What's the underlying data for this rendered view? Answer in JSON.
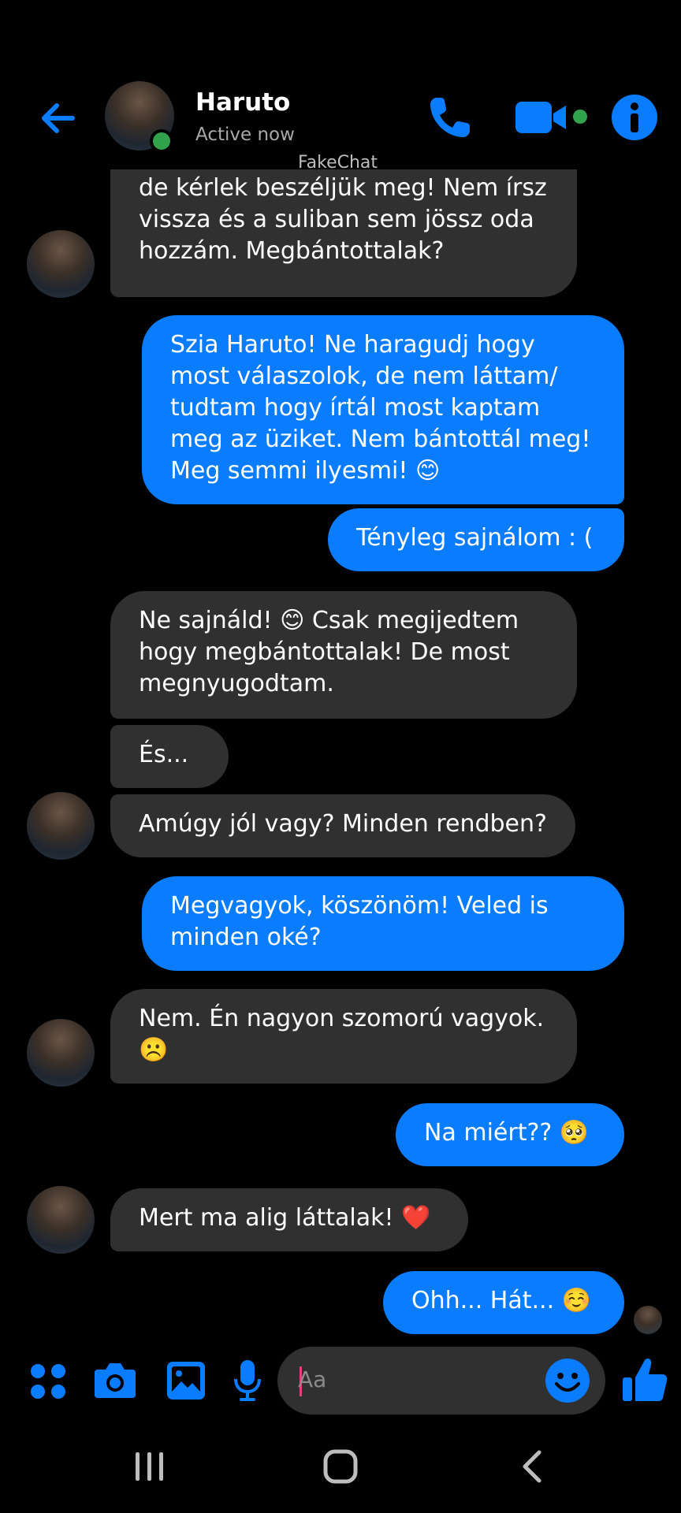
{
  "header": {
    "contact_name": "Haruto",
    "status": "Active now",
    "watermark": "FakeChat"
  },
  "messages": [
    {
      "side": "in",
      "text": "Szia Bora! Nem tudom mi a baj, de kérlek beszéljük meg! Nem írsz vissza és a suliban sem jössz oda hozzám. Megbántottalak?"
    },
    {
      "side": "out",
      "text": "Szia Haruto! Ne haragudj hogy most válaszolok, de nem láttam/ tudtam hogy írtál most kaptam meg az üziket. Nem bántottál meg! Meg semmi ilyesmi! 😊"
    },
    {
      "side": "out",
      "text": "Tényleg sajnálom : ("
    },
    {
      "side": "in",
      "text": "Ne sajnáld! 😊 Csak megijedtem hogy megbántottalak! De most megnyugodtam."
    },
    {
      "side": "in",
      "text": "És..."
    },
    {
      "side": "in",
      "text": "Amúgy jól vagy? Minden rendben?"
    },
    {
      "side": "out",
      "text": "Megvagyok, köszönöm! Veled is minden oké?"
    },
    {
      "side": "in",
      "text": "Nem. Én nagyon szomorú vagyok. ☹️"
    },
    {
      "side": "out",
      "text": "Na miért?? 🥺"
    },
    {
      "side": "in",
      "text": "Mert ma alig láttalak! ❤️"
    },
    {
      "side": "out",
      "text": "Ohh... Hát... ☺️"
    }
  ],
  "composer": {
    "placeholder": "Aa"
  },
  "colors": {
    "accent": "#0a7cff",
    "incoming_bubble": "#303030",
    "online": "#31a24c"
  },
  "icons": [
    "back-arrow-icon",
    "phone-icon",
    "video-camera-icon",
    "info-icon",
    "apps-grid-icon",
    "camera-icon",
    "gallery-icon",
    "microphone-icon",
    "emoji-icon",
    "thumbs-up-icon",
    "recents-icon",
    "home-icon",
    "nav-back-icon"
  ]
}
